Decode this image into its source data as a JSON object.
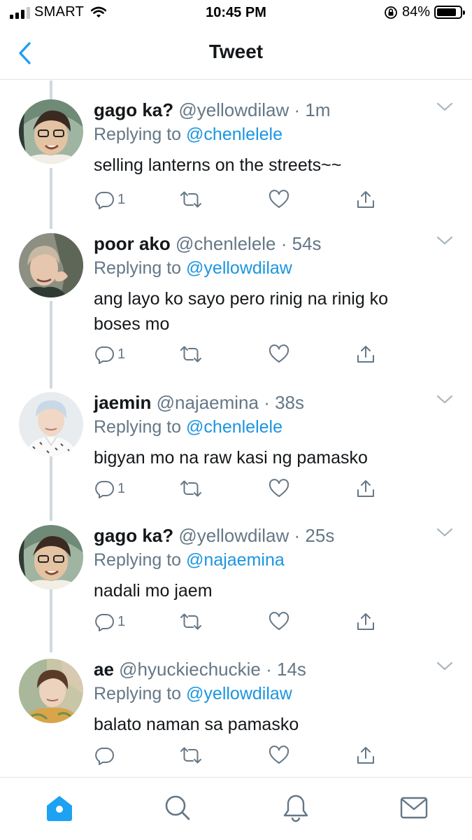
{
  "status_bar": {
    "carrier": "SMART",
    "time": "10:45 PM",
    "battery": "84%",
    "battery_level": 0.84
  },
  "header": {
    "title": "Tweet"
  },
  "reply_prefix": "Replying to",
  "tweets": [
    {
      "name": "gago ka?",
      "handle": "@yellowdilaw",
      "time": "· 1m",
      "replying_to": "@chenlelele",
      "text": "selling lanterns on the streets~~",
      "reply_count": "1"
    },
    {
      "name": "poor ako",
      "handle": "@chenlelele",
      "time": "· 54s",
      "replying_to": "@yellowdilaw",
      "text": "ang layo ko sayo pero rinig na rinig ko boses mo",
      "reply_count": "1"
    },
    {
      "name": "jaemin",
      "handle": "@najaemina",
      "time": "· 38s",
      "replying_to": "@chenlelele",
      "text": "bigyan mo na raw kasi ng pamasko",
      "reply_count": "1"
    },
    {
      "name": "gago ka?",
      "handle": "@yellowdilaw",
      "time": "· 25s",
      "replying_to": "@najaemina",
      "text": "nadali mo jaem",
      "reply_count": "1"
    },
    {
      "name": "ae",
      "handle": "@hyuckiechuckie",
      "time": "· 14s",
      "replying_to": "@yellowdilaw",
      "text": "balato naman sa pamasko",
      "reply_count": ""
    }
  ],
  "icons": {
    "back": "chevron-left-icon",
    "more": "chevron-down-icon",
    "reply": "comment-icon",
    "retweet": "retweet-icon",
    "like": "heart-icon",
    "share": "share-icon",
    "tab_home": "home-icon",
    "tab_search": "search-icon",
    "tab_notifications": "bell-icon",
    "tab_messages": "mail-icon"
  },
  "colors": {
    "accent": "#1da1f2",
    "link": "#1b95e0",
    "secondary_text": "#657786",
    "icon_gray": "#657786",
    "divider": "#dfe3e6"
  }
}
